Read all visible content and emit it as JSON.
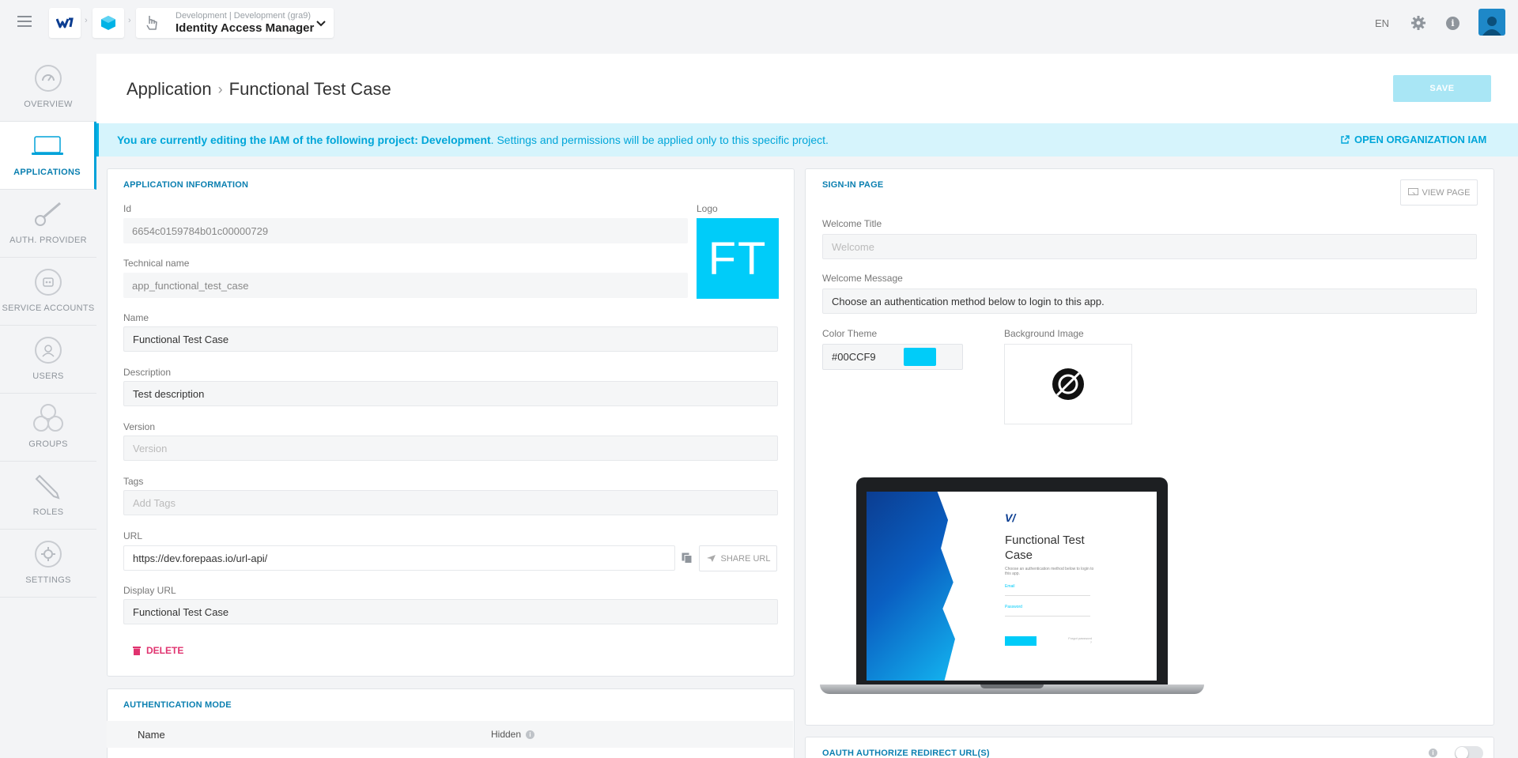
{
  "topbar": {
    "project_context": "Development | Development (gra9)",
    "app_name": "Identity Access Manager",
    "language": "EN"
  },
  "sidebar": {
    "items": [
      {
        "label": "OVERVIEW",
        "icon": "gauge-icon"
      },
      {
        "label": "APPLICATIONS",
        "icon": "laptop-icon"
      },
      {
        "label": "AUTH. PROVIDER",
        "icon": "key-icon"
      },
      {
        "label": "SERVICE ACCOUNTS",
        "icon": "robot-icon"
      },
      {
        "label": "USERS",
        "icon": "user-icon"
      },
      {
        "label": "GROUPS",
        "icon": "group-icon"
      },
      {
        "label": "ROLES",
        "icon": "pencil-icon"
      },
      {
        "label": "SETTINGS",
        "icon": "gear-icon"
      }
    ]
  },
  "header": {
    "breadcrumb_parent": "Application",
    "breadcrumb_current": "Functional Test Case",
    "save_label": "SAVE"
  },
  "banner": {
    "prefix": "You are currently editing the IAM of the following project: Development",
    "suffix": ". Settings and permissions will be applied only to this specific project.",
    "link_label": "OPEN ORGANIZATION IAM"
  },
  "app_info": {
    "title": "APPLICATION INFORMATION",
    "id_label": "Id",
    "id_value": "6654c0159784b01c00000729",
    "logo_label": "Logo",
    "logo_text": "FT",
    "tech_label": "Technical name",
    "tech_value": "app_functional_test_case",
    "name_label": "Name",
    "name_value": "Functional Test Case",
    "desc_label": "Description",
    "desc_value": "Test description",
    "version_label": "Version",
    "version_placeholder": "Version",
    "tags_label": "Tags",
    "tags_placeholder": "Add Tags",
    "url_label": "URL",
    "url_value": "https://dev.forepaas.io/url-api/",
    "share_label": "SHARE URL",
    "display_url_label": "Display URL",
    "display_url_value": "Functional Test Case",
    "delete_label": "DELETE"
  },
  "signin": {
    "title": "SIGN-IN PAGE",
    "view_page_label": "VIEW PAGE",
    "welcome_title_label": "Welcome Title",
    "welcome_title_placeholder": "Welcome",
    "welcome_message_label": "Welcome Message",
    "welcome_message_value": "Choose an authentication method below to login to this app.",
    "color_theme_label": "Color Theme",
    "color_theme_value": "#00CCF9",
    "bg_image_label": "Background Image",
    "preview": {
      "title": "Functional Test Case",
      "subtitle": "Choose an authentication method below to login to this app.",
      "email_label": "Email",
      "password_label": "Password",
      "login_label": "Log in",
      "forgot_label": "Forgot password ?"
    }
  },
  "auth_mode": {
    "title": "AUTHENTICATION MODE",
    "col_name": "Name",
    "col_hidden": "Hidden"
  },
  "oauth": {
    "title": "OAUTH AUTHORIZE REDIRECT URL(S)"
  },
  "colors": {
    "accent": "#00a6d9",
    "brand_cyan": "#00ccf9",
    "danger": "#e0336f"
  }
}
